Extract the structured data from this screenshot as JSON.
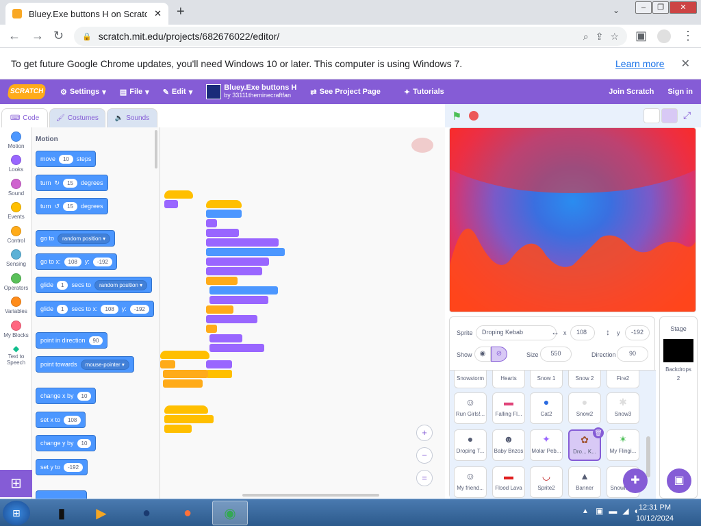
{
  "browser": {
    "tab_title": "Bluey.Exe buttons H on Scratch",
    "url": "scratch.mit.edu/projects/682676022/editor/",
    "info_message": "To get future Google Chrome updates, you'll need Windows 10 or later. This computer is using Windows 7.",
    "learn_more": "Learn more"
  },
  "menu": {
    "logo": "SCRATCH",
    "settings": "Settings",
    "file": "File",
    "edit": "Edit",
    "project_title": "Bluey.Exe buttons H",
    "project_author": "by 33111theminecraftfan",
    "see_project_page": "See Project Page",
    "tutorials": "Tutorials",
    "join": "Join Scratch",
    "sign_in": "Sign in"
  },
  "editor_tabs": {
    "code": "Code",
    "costumes": "Costumes",
    "sounds": "Sounds"
  },
  "categories": [
    {
      "label": "Motion",
      "color": "#4c97ff"
    },
    {
      "label": "Looks",
      "color": "#9966ff"
    },
    {
      "label": "Sound",
      "color": "#cf63cf"
    },
    {
      "label": "Events",
      "color": "#ffbf00"
    },
    {
      "label": "Control",
      "color": "#ffab19"
    },
    {
      "label": "Sensing",
      "color": "#5cb1d6"
    },
    {
      "label": "Operators",
      "color": "#59c059"
    },
    {
      "label": "Variables",
      "color": "#ff8c1a"
    },
    {
      "label": "My Blocks",
      "color": "#ff6680"
    },
    {
      "label": "Text to Speech",
      "color": "#0fbd8c"
    }
  ],
  "palette": {
    "header": "Motion",
    "move": {
      "a": "move",
      "v": "10",
      "b": "steps"
    },
    "turn_right": {
      "a": "turn",
      "v": "15",
      "b": "degrees"
    },
    "turn_left": {
      "a": "turn",
      "v": "15",
      "b": "degrees"
    },
    "goto": {
      "a": "go to",
      "d": "random position"
    },
    "goto_xy": {
      "a": "go to x:",
      "x": "108",
      "b": "y:",
      "y": "-192"
    },
    "glide": {
      "a": "glide",
      "v": "1",
      "b": "secs to",
      "d": "random position"
    },
    "glide_xy": {
      "a": "glide",
      "v": "1",
      "b": "secs to x:",
      "x": "108",
      "c": "y:",
      "y": "-192"
    },
    "point_dir": {
      "a": "point in direction",
      "v": "90"
    },
    "point_towards": {
      "a": "point towards",
      "d": "mouse-pointer"
    },
    "change_x": {
      "a": "change x by",
      "v": "10"
    },
    "set_x": {
      "a": "set x to",
      "v": "108"
    },
    "change_y": {
      "a": "change y by",
      "v": "10"
    },
    "set_y": {
      "a": "set y to",
      "v": "-192"
    }
  },
  "sprite_info": {
    "sprite_label": "Sprite",
    "sprite_name": "Droping Kebab",
    "x_label": "x",
    "x": "108",
    "y_label": "y",
    "y": "-192",
    "show_label": "Show",
    "size_label": "Size",
    "size": "550",
    "direction_label": "Direction",
    "direction": "90"
  },
  "sprites": [
    {
      "name": "Snowstorm"
    },
    {
      "name": "Hearts"
    },
    {
      "name": "Snow 1"
    },
    {
      "name": "Snow 2"
    },
    {
      "name": "Fire2"
    },
    {
      "name": "Run Girls!..."
    },
    {
      "name": "Falling Fl..."
    },
    {
      "name": "Cat2"
    },
    {
      "name": "Snow2"
    },
    {
      "name": "Snow3"
    },
    {
      "name": "Droping T..."
    },
    {
      "name": "Baby Bnzos"
    },
    {
      "name": "Molar Peb..."
    },
    {
      "name": "Dro... K..."
    },
    {
      "name": "My Flingi..."
    },
    {
      "name": "My friend..."
    },
    {
      "name": "Flood Lava"
    },
    {
      "name": "Sprite2"
    },
    {
      "name": "Banner"
    },
    {
      "name": "Snowflake"
    }
  ],
  "stage_panel": {
    "title": "Stage",
    "backdrops_label": "Backdrops",
    "backdrops_count": "2"
  },
  "taskbar": {
    "time": "12:31 PM",
    "date": "10/12/2024"
  }
}
